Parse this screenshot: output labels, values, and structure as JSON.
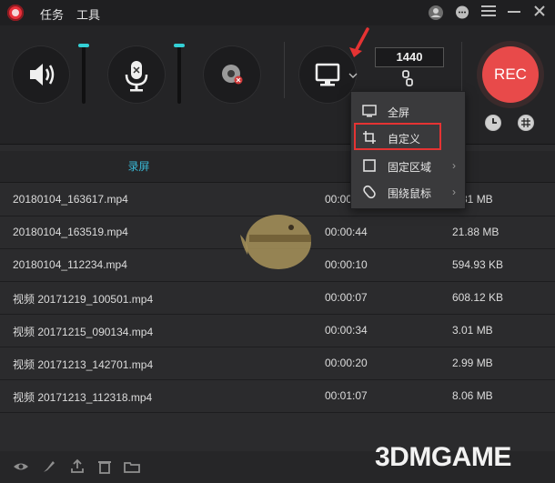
{
  "titlebar": {
    "menu": [
      "任务",
      "工具"
    ]
  },
  "controls": {
    "resolution": "1440",
    "rec_label": "REC"
  },
  "popup": {
    "items": [
      {
        "label": "全屏",
        "icon": "monitor-icon"
      },
      {
        "label": "自定义",
        "icon": "crop-icon",
        "highlighted": true
      },
      {
        "label": "固定区域",
        "icon": "frame-icon",
        "submenu": true
      },
      {
        "label": "围绕鼠标",
        "icon": "mouse-icon",
        "submenu": true
      }
    ]
  },
  "tabs": {
    "active": "录屏"
  },
  "recordings": [
    {
      "name": "20180104_163617.mp4",
      "duration": "00:00:",
      "size": "9.81 MB"
    },
    {
      "name": "20180104_163519.mp4",
      "duration": "00:00:44",
      "size": "21.88 MB"
    },
    {
      "name": "20180104_112234.mp4",
      "duration": "00:00:10",
      "size": "594.93 KB"
    },
    {
      "name": "视频 20171219_100501.mp4",
      "duration": "00:00:07",
      "size": "608.12 KB"
    },
    {
      "name": "视频 20171215_090134.mp4",
      "duration": "00:00:34",
      "size": "3.01 MB"
    },
    {
      "name": "视频 20171213_142701.mp4",
      "duration": "00:00:20",
      "size": "2.99 MB"
    },
    {
      "name": "视频 20171213_112318.mp4",
      "duration": "00:01:07",
      "size": "8.06 MB"
    }
  ],
  "watermark": "3DMGAME",
  "colors": {
    "accent": "#39b8d6",
    "rec": "#e84a4a",
    "highlight": "#e53333"
  }
}
